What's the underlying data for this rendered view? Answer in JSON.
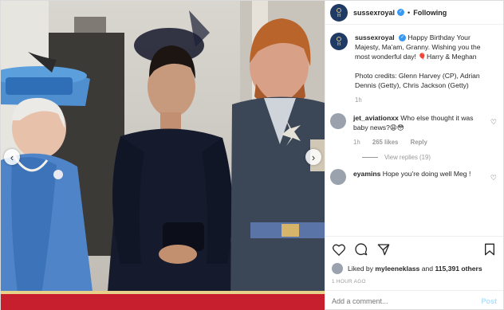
{
  "post": {
    "username": "sussexroyal",
    "follow_state": "Following",
    "separator": "•",
    "caption_user": "sussexroyal",
    "caption_text": "Happy Birthday Your Majesty, Ma'am, Granny. Wishing you the most wonderful day! 🎈Harry & Meghan",
    "credits_text": "Photo credits: Glenn Harvey (CP), Adrian Dennis (Getty), Chris Jackson (Getty)",
    "credits_time": "1h"
  },
  "comments": [
    {
      "username": "jet_aviationxx",
      "text": "Who else thought it was baby news?😩😳",
      "time": "1h",
      "likes": "265 likes",
      "reply": "Reply",
      "view_replies": "View replies (19)"
    },
    {
      "username": "eyamins",
      "text": "Hope you're doing well Meg !"
    }
  ],
  "likes": {
    "prefix": "Liked by",
    "user": "myleeneklass",
    "conj": "and",
    "count": "115,391 others"
  },
  "timestamp": "1 HOUR AGO",
  "add_comment": {
    "placeholder": "Add a comment...",
    "post_label": "Post"
  },
  "icons": {
    "like": "heart-icon",
    "comment": "comment-icon",
    "share": "share-icon",
    "save": "bookmark-icon",
    "verified": "verified-badge-icon"
  },
  "colors": {
    "verified": "#3897f0",
    "avatar": "#1f3a64",
    "muted": "#999999",
    "post_disabled": "#b2dffc"
  }
}
